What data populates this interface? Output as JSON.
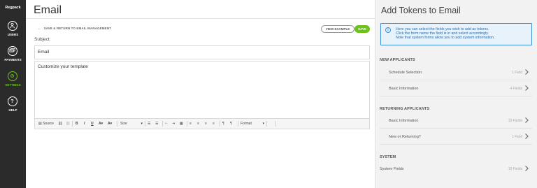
{
  "nav": {
    "logo": "Regpack",
    "items": [
      {
        "label": "USERS",
        "icon": "user-icon"
      },
      {
        "label": "PAYMENTS",
        "icon": "payments-icon"
      },
      {
        "label": "SETTINGS",
        "icon": "settings-icon"
      },
      {
        "label": "HELP",
        "icon": "help-icon"
      }
    ],
    "active": "SETTINGS",
    "accent": "#6fc21c"
  },
  "main": {
    "title": "Email",
    "back_link": "SAVE & RETURN TO EMAIL MANAGEMENT",
    "view_example_label": "VIEW EXAMPLE",
    "save_label": "SAVE",
    "subject_label": "Subject:",
    "subject_value": "Email",
    "editor_text": "Customize your template",
    "toolbar": {
      "source_label": "Source",
      "size_label": "Size",
      "format_label": "Format"
    }
  },
  "side": {
    "title": "Add Tokens to Email",
    "info": [
      "Here you can select the fields you wish to add as tokens.",
      "Click the form name the field is in and select accordingly.",
      "Note that system forms allow you to add system information."
    ],
    "sections": [
      {
        "heading": "NEW APPLICANTS",
        "rows": [
          {
            "name": "Schedule Selection",
            "count": "1 Field"
          },
          {
            "name": "Basic Information",
            "count": "4 Fields"
          }
        ]
      },
      {
        "heading": "RETURNING APPLICANTS",
        "rows": [
          {
            "name": "Basic Information",
            "count": "10 Fields"
          },
          {
            "name": "New or Returning?",
            "count": "1 Field"
          }
        ]
      },
      {
        "heading": "SYSTEM",
        "rows": [
          {
            "name": "System Fields",
            "count": "10 Fields"
          }
        ]
      }
    ],
    "info_color": "#3b8fd9"
  }
}
